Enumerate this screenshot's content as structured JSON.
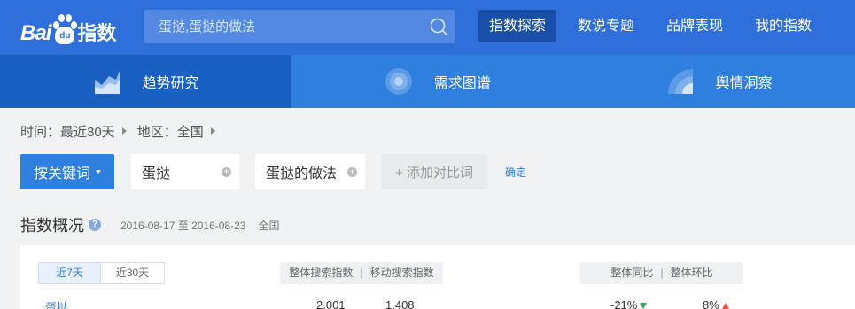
{
  "header": {
    "logo_text": "Bai",
    "logo_paw_text": "du",
    "logo_suffix": "指数",
    "search": {
      "placeholder": "蛋挞,蛋挞的做法"
    },
    "nav": [
      {
        "label": "指数探索",
        "active": true
      },
      {
        "label": "数说专题"
      },
      {
        "label": "品牌表现"
      },
      {
        "label": "我的指数"
      }
    ]
  },
  "subnav": [
    {
      "label": "趋势研究",
      "icon": "area-chart-icon",
      "active": true
    },
    {
      "label": "需求图谱",
      "icon": "radar-icon"
    },
    {
      "label": "舆情洞察",
      "icon": "signal-icon"
    }
  ],
  "filters": {
    "time_label": "时间：最近30天",
    "region_label": "地区：全国"
  },
  "keywords": {
    "mode_button": "按关键词",
    "items": [
      "蛋挞",
      "蛋挞的做法"
    ],
    "add_label": "+ 添加对比词",
    "confirm_label": "确定"
  },
  "overview": {
    "title": "指数概况",
    "help": "?",
    "dates": "2016-08-17 至 2016-08-23",
    "region": "全国"
  },
  "panel": {
    "range_tabs": [
      {
        "label": "近7天",
        "active": true
      },
      {
        "label": "近30天"
      }
    ],
    "head_left": [
      "整体搜索指数",
      "移动搜索指数"
    ],
    "head_right": [
      "整体同比",
      "整体环比"
    ],
    "separator": "|",
    "rows": [
      {
        "keyword": "蛋挞",
        "overall": "2,001",
        "mobile": "1,408",
        "yoy": "-21%",
        "mom": "8%"
      }
    ]
  },
  "colors": {
    "topbar": "#2f6fda",
    "subnav": "#2f7fde",
    "accent": "#2f7fde",
    "down": "#34a853",
    "up": "#e74c3c"
  }
}
